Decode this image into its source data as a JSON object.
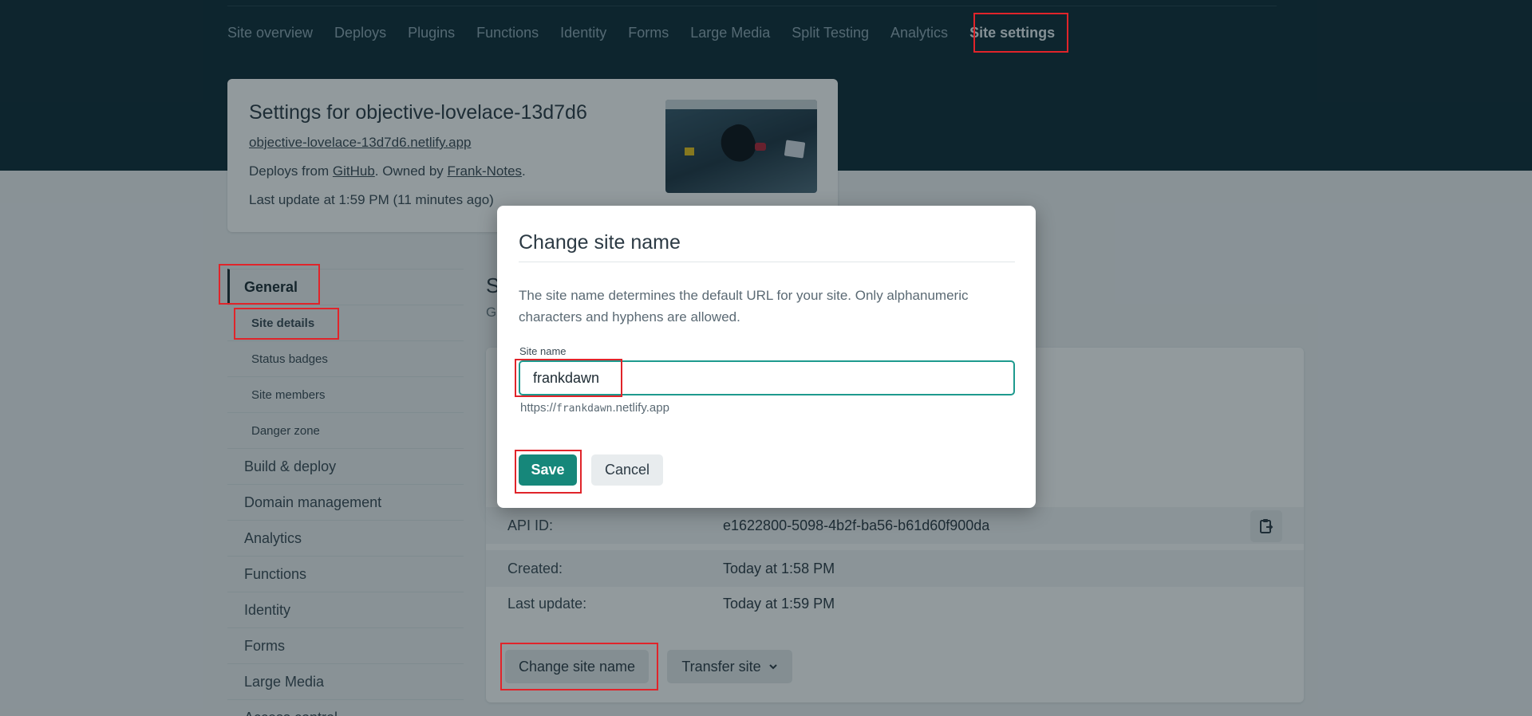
{
  "topnav": {
    "tabs": [
      {
        "label": "Site overview"
      },
      {
        "label": "Deploys"
      },
      {
        "label": "Plugins"
      },
      {
        "label": "Functions"
      },
      {
        "label": "Identity"
      },
      {
        "label": "Forms"
      },
      {
        "label": "Large Media"
      },
      {
        "label": "Split Testing"
      },
      {
        "label": "Analytics"
      },
      {
        "label": "Site settings"
      }
    ],
    "active_index": 9
  },
  "site_card": {
    "title": "Settings for objective-lovelace-13d7d6",
    "url": "objective-lovelace-13d7d6.netlify.app",
    "deploys_prefix": "Deploys from ",
    "deploys_source": "GitHub",
    "owned_prefix": ". Owned by ",
    "owner": "Frank-Notes",
    "owned_suffix": ".",
    "last_update": "Last update at 1:59 PM (11 minutes ago)"
  },
  "sidebar": {
    "section": "General",
    "subitems": [
      {
        "label": "Site details"
      },
      {
        "label": "Status badges"
      },
      {
        "label": "Site members"
      },
      {
        "label": "Danger zone"
      }
    ],
    "items": [
      {
        "label": "Build & deploy"
      },
      {
        "label": "Domain management"
      },
      {
        "label": "Analytics"
      },
      {
        "label": "Functions"
      },
      {
        "label": "Identity"
      },
      {
        "label": "Forms"
      },
      {
        "label": "Large Media"
      },
      {
        "label": "Access control"
      }
    ]
  },
  "main": {
    "title_fragment": "S",
    "subtitle_fragment": "G",
    "details": [
      {
        "label": "API ID:",
        "value": "e1622800-5098-4b2f-ba56-b61d60f900da"
      },
      {
        "label": "Created:",
        "value": "Today at 1:58 PM"
      },
      {
        "label": "Last update:",
        "value": "Today at 1:59 PM"
      }
    ],
    "change_site_name_label": "Change site name",
    "transfer_site_label": "Transfer site"
  },
  "modal": {
    "title": "Change site name",
    "description": "The site name determines the default URL for your site. Only alphanumeric characters and hyphens are allowed.",
    "field_label": "Site name",
    "field_value": "frankdawn",
    "hint_prefix": "https://",
    "hint_name": "frankdawn",
    "hint_suffix": ".netlify.app",
    "save_label": "Save",
    "cancel_label": "Cancel"
  },
  "colors": {
    "header_bg": "#0e2a35",
    "accent_teal": "#16877a",
    "annotation_red": "#e0242a"
  },
  "icons": {
    "copy": "clipboard-copy-icon",
    "chevron": "chevron-down-icon"
  }
}
